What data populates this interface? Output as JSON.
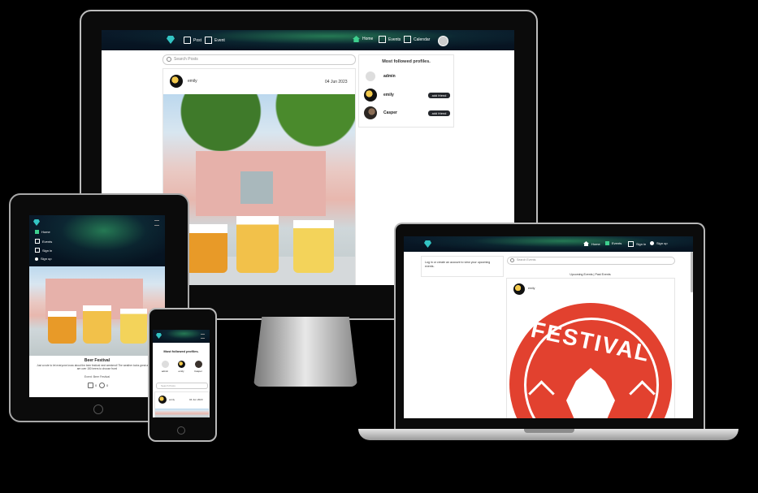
{
  "brand": {
    "logo_icon": "diamond-icon",
    "accent": "#33c4c4"
  },
  "desktop": {
    "nav": {
      "post": "Post",
      "event": "Event",
      "home": "Home",
      "events": "Events",
      "calendar": "Calendar"
    },
    "search_placeholder": "Search Posts",
    "post": {
      "user": "emily",
      "date": "04 Jun 2023"
    },
    "profiles": {
      "title": "Most followed profiles.",
      "items": [
        {
          "name": "admin",
          "button": ""
        },
        {
          "name": "emily",
          "button": "add friend"
        },
        {
          "name": "Casper",
          "button": "add friend"
        }
      ]
    }
  },
  "tablet": {
    "menu": [
      "Home",
      "Events",
      "Sign in",
      "Sign up"
    ],
    "post_title": "Beer Festival",
    "post_text": "Just a note to let everyone know about the beer festival next weekend! The weather looks great and there are over 150 beers to choose from!",
    "event_link": "Event: Beer Festival",
    "likes": "0",
    "comments": "0"
  },
  "phone": {
    "profiles_title": "Most followed profiles.",
    "profiles": [
      "admin",
      "emily",
      "Casper"
    ],
    "search_placeholder": "Search Posts",
    "post": {
      "user": "emily",
      "date": "04 Jun 2023"
    }
  },
  "laptop": {
    "nav": {
      "home": "Home",
      "events": "Events",
      "signin": "Sign in",
      "signup": "Sign up"
    },
    "login_notice": "Log in or create an account to view your upcoming events.",
    "search_placeholder": "Search Events",
    "tabs": "Upcoming Events | Past Events",
    "post_user": "emily",
    "festival_text": "FESTIVAL"
  }
}
